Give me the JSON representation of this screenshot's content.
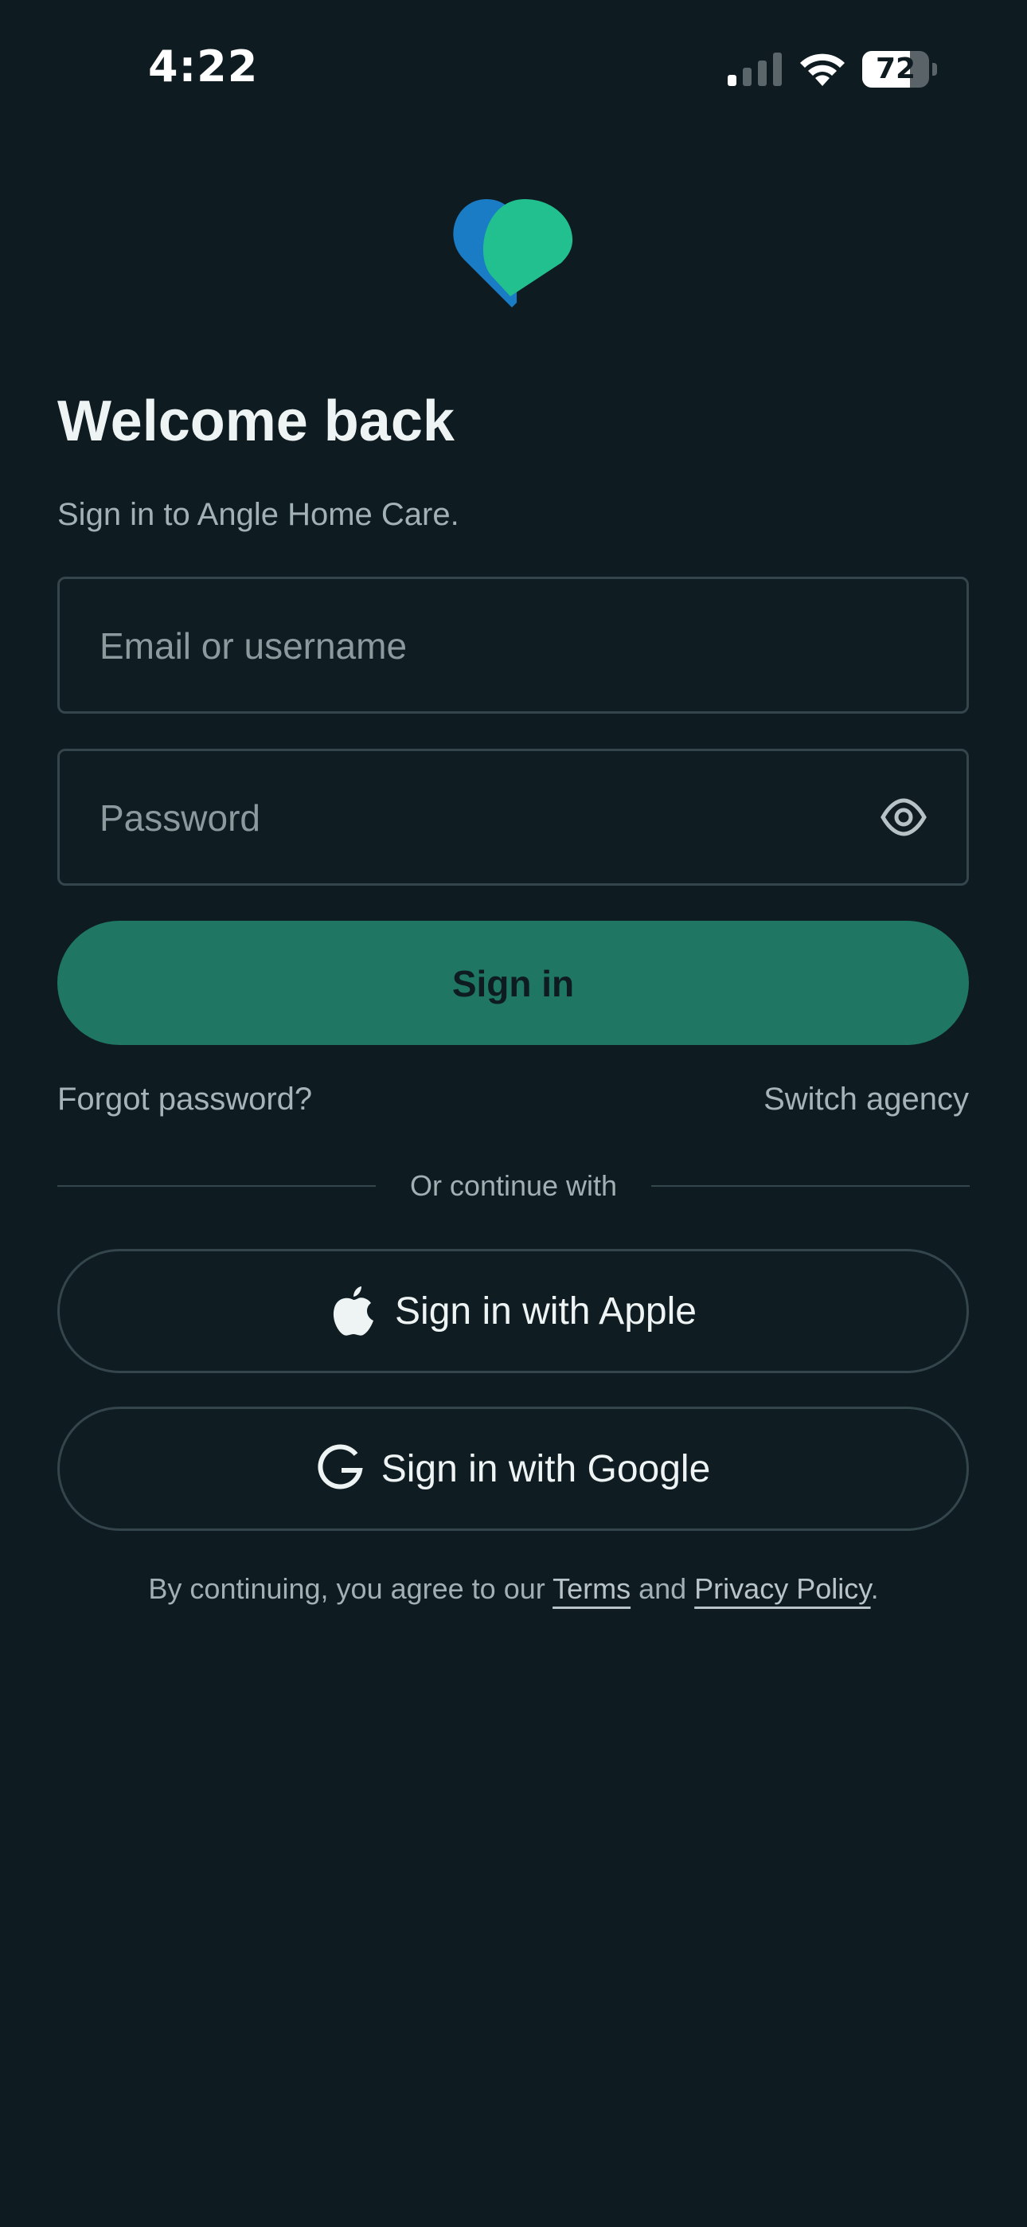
{
  "status_bar": {
    "time": "4:22",
    "battery_level": "72",
    "battery_fraction": 0.72
  },
  "colors": {
    "background": "#0e1b21",
    "primary": "#1f7663",
    "logo_blue": "#1a7cc4",
    "logo_green": "#22c08f"
  },
  "header": {
    "logo_icon": "heart-logo-icon",
    "title": "Welcome back",
    "subtitle": "Sign in to Angle Home Care."
  },
  "form": {
    "email": {
      "value": "",
      "placeholder": "Email or username"
    },
    "password": {
      "value": "",
      "placeholder": "Password",
      "toggle_icon": "eye-icon"
    },
    "submit_label": "Sign in"
  },
  "links": {
    "forgot_password": "Forgot password?",
    "switch_agency": "Switch agency"
  },
  "divider": {
    "label": "Or continue with"
  },
  "social": {
    "apple": {
      "label": "Sign in with Apple",
      "icon": "apple-icon"
    },
    "google": {
      "label": "Sign in with Google",
      "icon": "google-icon"
    }
  },
  "legal": {
    "prefix": "By continuing, you agree to our ",
    "terms": "Terms",
    "and": " and ",
    "privacy": "Privacy Policy",
    "suffix": "."
  }
}
